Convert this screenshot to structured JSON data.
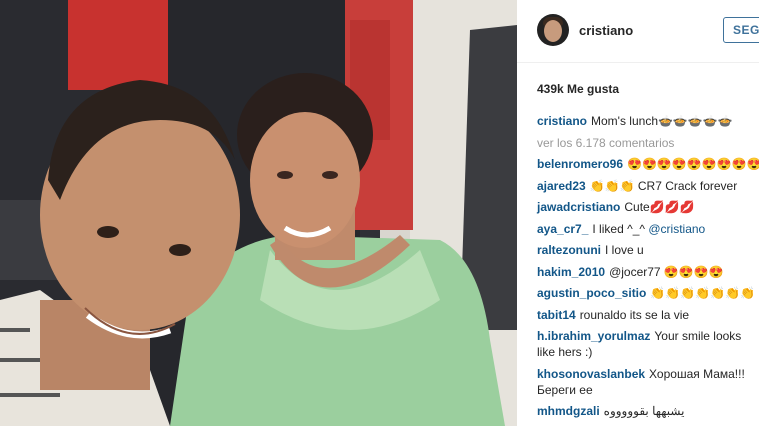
{
  "post": {
    "username": "cristiano",
    "follow_label": "SEGU",
    "likes": "439k Me gusta",
    "caption_user": "cristiano",
    "caption_text": "Mom's lunch🍲🍲🍲🍲🍲",
    "view_comments": "ver los 6.178 comentarios"
  },
  "comments": [
    {
      "user": "belenromero96",
      "text": "😍😍😍😍😍😍😍😍😍😍😍😍😍😍"
    },
    {
      "user": "ajared23",
      "text": "👏👏👏 CR7 Crack forever"
    },
    {
      "user": "jawadcristiano",
      "text": "Cute💋💋💋"
    },
    {
      "user": "aya_cr7_",
      "text": "I liked ^_^ ",
      "mention": "@cristiano"
    },
    {
      "user": "raltezonuni",
      "text": "I love u"
    },
    {
      "user": "hakim_2010",
      "text": "@jocer77 😍😍😍😍"
    },
    {
      "user": "agustin_poco_sitio",
      "text": "👏👏👏👏👏👏👏"
    },
    {
      "user": "tabit14",
      "text": "rounaldo its se la vie"
    },
    {
      "user": "h.ibrahim_yorulmaz",
      "text": "Your smile looks like hers :)"
    },
    {
      "user": "khosonovaslanbek",
      "text": "Хорошая Мама!!! Береги ее"
    },
    {
      "user": "mhmdgzali",
      "text": "يشبهها بقوووووه"
    }
  ]
}
